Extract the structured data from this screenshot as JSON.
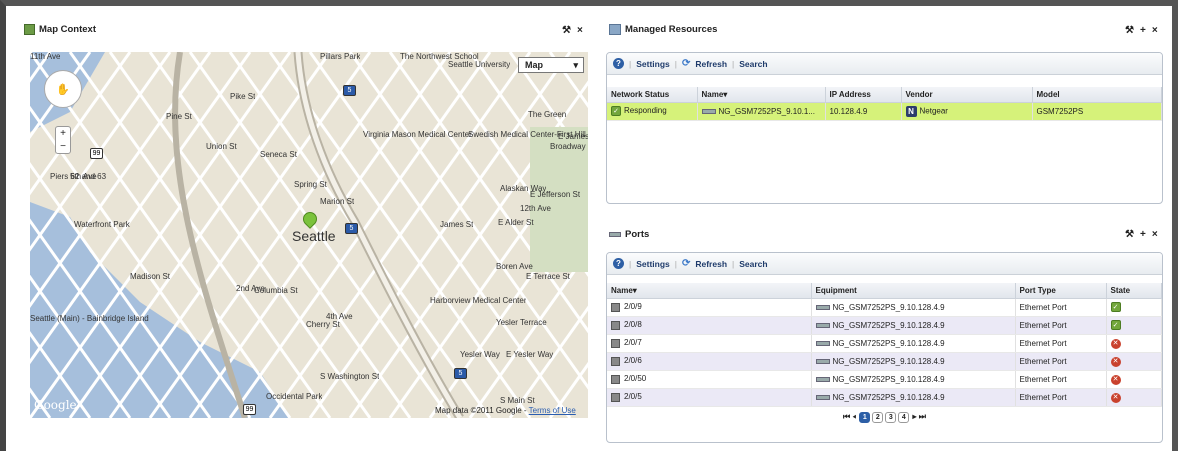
{
  "map_panel": {
    "title": "Map Context",
    "map_type": "Map",
    "attribution": "Map data ©2011 Google -",
    "terms": "Terms of Use",
    "logo": "Google",
    "labels": [
      "Seattle",
      "The Northwest School",
      "Pillars Park",
      "The Green",
      "Virginia Mason Medical Center",
      "Swedish Medical Center-First Hill Campus",
      "Piers 62 and 63",
      "Waterfront Park",
      "Harborview Medical Center",
      "Yesler Terrace",
      "Occidental Park",
      "Seattle (Main) - Bainbridge Island",
      "Seattle University",
      "Yesler Way",
      "E Yesler Way",
      "S Washington St",
      "S Main St",
      "Madison St",
      "Spring St",
      "Pike St",
      "Pine St",
      "Union St",
      "Seneca St",
      "Marion St",
      "Cherry St",
      "James St",
      "Columbia St",
      "2nd Ave",
      "4th Ave",
      "5th Ave",
      "Alaskan Way",
      "Broadway",
      "Boren Ave",
      "E Terrace St",
      "E Alder St",
      "E Jefferson St",
      "E James Way",
      "12th Ave",
      "11th Ave"
    ],
    "shields": [
      "5",
      "5",
      "5",
      "99",
      "99"
    ]
  },
  "managed": {
    "title": "Managed Resources",
    "toolbar": {
      "settings": "Settings",
      "refresh": "Refresh",
      "search": "Search"
    },
    "columns": [
      "Network Status",
      "Name▾",
      "IP Address",
      "Vendor",
      "Model"
    ],
    "rows": [
      {
        "status": "Responding",
        "name": "NG_GSM7252PS_9.10.1...",
        "ip": "10.128.4.9",
        "vendor_icon": "N",
        "vendor": "Netgear",
        "model": "GSM7252PS"
      }
    ]
  },
  "ports": {
    "title": "Ports",
    "toolbar": {
      "settings": "Settings",
      "refresh": "Refresh",
      "search": "Search"
    },
    "columns": [
      "Name▾",
      "Equipment",
      "Port Type",
      "State"
    ],
    "rows": [
      {
        "name": "2/0/9",
        "equipment": "NG_GSM7252PS_9.10.128.4.9",
        "type": "Ethernet Port",
        "state": "ok"
      },
      {
        "name": "2/0/8",
        "equipment": "NG_GSM7252PS_9.10.128.4.9",
        "type": "Ethernet Port",
        "state": "ok"
      },
      {
        "name": "2/0/7",
        "equipment": "NG_GSM7252PS_9.10.128.4.9",
        "type": "Ethernet Port",
        "state": "down"
      },
      {
        "name": "2/0/6",
        "equipment": "NG_GSM7252PS_9.10.128.4.9",
        "type": "Ethernet Port",
        "state": "down"
      },
      {
        "name": "2/0/50",
        "equipment": "NG_GSM7252PS_9.10.128.4.9",
        "type": "Ethernet Port",
        "state": "down"
      },
      {
        "name": "2/0/5",
        "equipment": "NG_GSM7252PS_9.10.128.4.9",
        "type": "Ethernet Port",
        "state": "down"
      }
    ],
    "pages": [
      "1",
      "2",
      "3",
      "4"
    ],
    "current_page": "1"
  },
  "controls": {
    "wrench": "⚒",
    "plus": "+",
    "close": "×"
  },
  "colors": {
    "selected_row": "#d6f27a",
    "alt_row": "#ebe9f6",
    "ok": "#73a73c",
    "error": "#c9412d",
    "toolbar_text": "#1f3b6b"
  }
}
